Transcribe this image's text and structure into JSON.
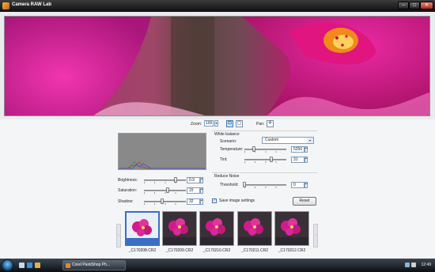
{
  "window": {
    "title": "Camera RAW Lab",
    "min_label": "–",
    "max_label": "□",
    "close_label": "✕"
  },
  "toolbar": {
    "zoom_label": "Zoom:",
    "zoom_value": "100",
    "zoom_spin": "▾",
    "pan_label": "Pan:",
    "pan_icon_glyph": "✛",
    "fit_icon_glyph": "⊡",
    "actual_icon_glyph": "▢"
  },
  "histogram": {
    "colors": {
      "background": "#898989",
      "red": "#d43030",
      "green": "#2e9a2e",
      "blue": "#3255d8"
    }
  },
  "adjustments": [
    {
      "label": "Brightness:",
      "value": "0.9",
      "level": 0.76
    },
    {
      "label": "Saturation:",
      "value": "15",
      "level": 0.57
    },
    {
      "label": "Shadow:",
      "value": "32",
      "level": 0.43
    }
  ],
  "white_balance": {
    "title": "White balance",
    "scenario_label": "Scenario:",
    "scenario_value": "Custom",
    "temperature_label": "Temperature:",
    "temperature_value": "5250",
    "temperature_level": 0.22,
    "tint_label": "Tint:",
    "tint_value": "31",
    "tint_level": 0.64
  },
  "reduce_noise": {
    "title": "Reduce Noise",
    "threshold_label": "Threshold:",
    "threshold_value": "0",
    "threshold_level": 0.0
  },
  "save_settings": {
    "label": "Save image settings",
    "checked": true,
    "check_glyph": "✓"
  },
  "reset_label": "Reset",
  "filmstrip": {
    "prev_glyph": "‹",
    "next_glyph": "›",
    "items": [
      {
        "caption": "_C170208.CR2",
        "selected": true
      },
      {
        "caption": "_C170209.CR2",
        "selected": false
      },
      {
        "caption": "_C170210.CR2",
        "selected": false
      },
      {
        "caption": "_C170211.CR2",
        "selected": false
      },
      {
        "caption": "_C170212.CR2",
        "selected": false
      }
    ]
  },
  "taskbar": {
    "task_label": "Corel PaintShop Ph...",
    "clock": "12:49"
  },
  "colors": {
    "accent": "#3a6fc3",
    "flower": "#d21b8a"
  }
}
